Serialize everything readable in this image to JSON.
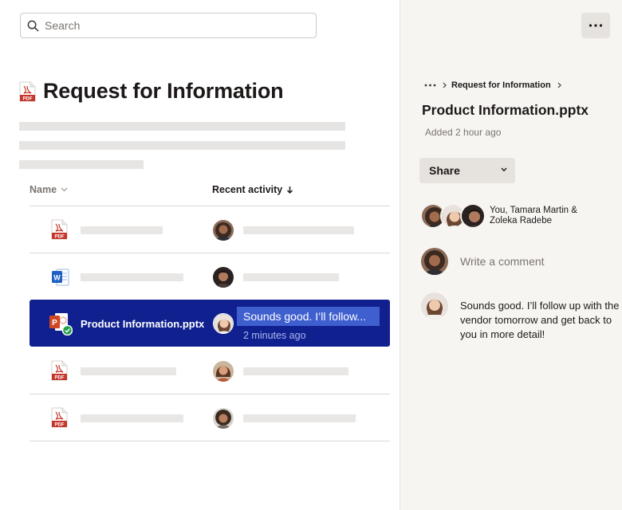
{
  "search": {
    "placeholder": "Search"
  },
  "folder": {
    "title": "Request for Information"
  },
  "table": {
    "columns": {
      "name": "Name",
      "recent": "Recent activity"
    },
    "selected_row": {
      "file_name": "Product Information.pptx",
      "activity_text": "Sounds good. I’ll follow...",
      "activity_time": "2 minutes ago"
    },
    "rows": [
      {
        "file_icon": "pdf-file-icon"
      },
      {
        "file_icon": "word-file-icon"
      },
      {
        "file_icon": "powerpoint-file-icon",
        "selected": true
      },
      {
        "file_icon": "pdf-file-icon"
      },
      {
        "file_icon": "pdf-file-icon"
      }
    ]
  },
  "panel": {
    "breadcrumb": {
      "parent": "Request for Information"
    },
    "file_title": "Product Information.pptx",
    "added": "Added 2 hour ago",
    "share_label": "Share",
    "people_line1": "You, Tamara  Martin &",
    "people_line2": "Zoleka Radebe",
    "comment_placeholder": "Write a comment",
    "comment_text": "Sounds good. I’ll follow up with the vendor tomorrow and get back to you in more detail!"
  },
  "colors": {
    "selected_row": "#10218f",
    "selected_highlight": "#3f5fcf",
    "pdf_red": "#c4362a",
    "word_blue": "#1f5fc4",
    "ppt_orange": "#d24625",
    "panel_bg": "#f7f5f2",
    "skeleton": "#e7e5e3"
  }
}
